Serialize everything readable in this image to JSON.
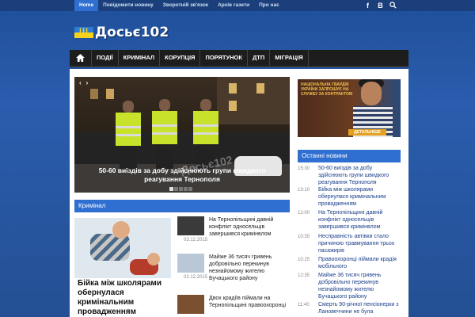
{
  "topnav": [
    "Home",
    "Повідомити новину",
    "Зворотній зв'язок",
    "Архів газети",
    "Про нас"
  ],
  "social": {
    "facebook": "f",
    "vk": "В",
    "search_icon": "search-icon"
  },
  "logo": "Досьє102",
  "mainnav": {
    "home_icon": "home-icon",
    "items": [
      "ПОДІЇ",
      "КРИМІНАЛ",
      "КОРУПЦІЯ",
      "ПОРЯТУНОК",
      "ДТП",
      "МІГРАЦІЯ"
    ]
  },
  "slider": {
    "prev": "‹",
    "next": "›",
    "caption": "50-60 виїздів за добу здійснюють групи швидкого реагування Тернополя",
    "watermark": "Досьє102"
  },
  "criminal": {
    "heading": "Кримінал",
    "featured_title": "Бійка між школярами обернулася кримінальним провадженням",
    "items": [
      {
        "title": "На Тернопільщині давній конфлікт односельців завершився кримінвлом",
        "date": "03.12.2015"
      },
      {
        "title": "Майже 36 тисяч гривень добровільно перекинув незнайомому жителю Бучацького району",
        "date": "02.12.2015"
      },
      {
        "title": "Двох крадіїв пiймали на Тернопільщині правоохоронці",
        "date": ""
      }
    ]
  },
  "ad": {
    "text": "Національна гвардія України запрошує на службу за контрактом",
    "button": "ДЕТАЛЬНІШЕ"
  },
  "latest": {
    "heading": "Останні новини",
    "items": [
      {
        "time": "15:30",
        "title": "50-60 виїздів за добу здійснюють групи швидкого реагування Тернополя"
      },
      {
        "time": "13:10",
        "title": "Бійка між школярами обернулася кримінальним провадженням"
      },
      {
        "time": "12:00",
        "title": "На Тернопільщині давній конфлікт односельців завершився кримінвлом"
      },
      {
        "time": "10:35",
        "title": "Несправність автівки стало причиною травмування трьох пасажирів"
      },
      {
        "time": "10:25",
        "title": "Правоохоронці пiймали крадія мобільного"
      },
      {
        "time": "12:35",
        "title": "Майже 36 тисяч гривень добровільно перекинув незнайомому жителю Бучацького району"
      },
      {
        "time": "11:40",
        "title": "Смерть 90-річної пенсіонерки з Лановеччини не була"
      }
    ]
  }
}
